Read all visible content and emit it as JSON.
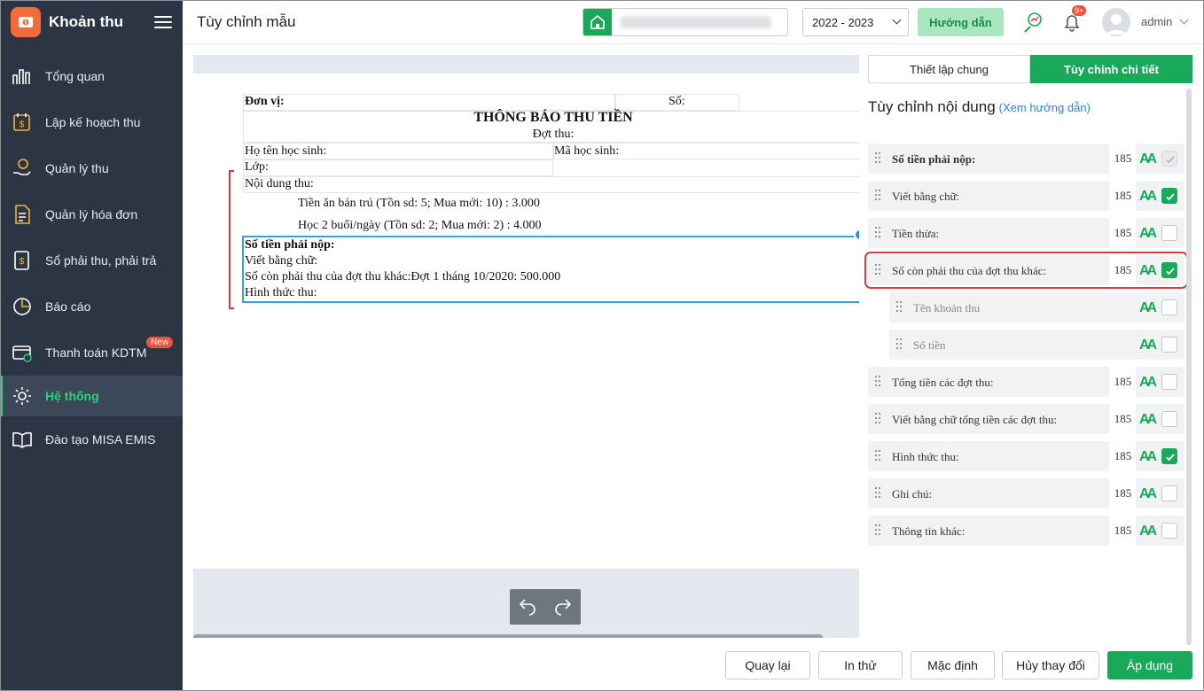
{
  "app": {
    "title": "Khoản thu"
  },
  "sidebar": {
    "items": [
      {
        "label": "Tổng quan"
      },
      {
        "label": "Lập kế hoạch thu"
      },
      {
        "label": "Quản lý thu"
      },
      {
        "label": "Quản lý hóa đơn"
      },
      {
        "label": "Sổ phải thu, phải trả"
      },
      {
        "label": "Báo cáo"
      },
      {
        "label": "Thanh toán KDTM",
        "badge": "New"
      },
      {
        "label": "Hệ thống",
        "active": true
      },
      {
        "label": "Đào tạo MISA EMIS"
      }
    ]
  },
  "header": {
    "page_title": "Tùy chỉnh mẫu",
    "year": "2022 - 2023",
    "guide_label": "Hướng dẫn",
    "notif_count": "9+",
    "username": "admin"
  },
  "doc": {
    "don_vi": "Đơn vị:",
    "so": "Số:",
    "title": "THÔNG BÁO THU TIỀN",
    "dot_thu": "Đợt thu:",
    "ho_ten": "Họ tên học sinh:",
    "ma_hs": "Mã học sinh:",
    "lop": "Lớp:",
    "noi_dung": "Nội dung thu:",
    "item1": "Tiền ăn bán trú (Tồn sd: 5; Mua mới: 10)   : 3.000",
    "item2": "Học 2 buổi/ngày (Tồn sd: 2; Mua mới: 2)   : 4.000",
    "so_tien": "Số tiền phải nộp:",
    "viet_bang_chu": "Viết bằng chữ:",
    "so_con": "Số còn phải thu của đợt thu khác:Đợt 1 tháng 10/2020: 500.000",
    "hinh_thuc": "Hình thức thu:"
  },
  "panel": {
    "tab_general": "Thiết lập chung",
    "tab_detail": "Tùy chỉnh chi tiết",
    "title": "Tùy chỉnh nội dung",
    "guide_link": "(Xem hướng dẫn)",
    "font_glyph": "A",
    "rows": [
      {
        "label": "Số tiền phải nộp:",
        "num": "185",
        "state": "disabled",
        "bold": true
      },
      {
        "label": "Viết bằng chữ:",
        "num": "185",
        "state": "on"
      },
      {
        "label": "Tiền thừa:",
        "num": "185",
        "state": "off"
      },
      {
        "label": "Số còn phải thu của đợt thu khác:",
        "num": "185",
        "state": "on",
        "highlight": true
      },
      {
        "label": "Tên khoản thu",
        "num": "",
        "state": "off",
        "child": true
      },
      {
        "label": "Số tiền",
        "num": "",
        "state": "off",
        "child": true
      },
      {
        "label": "Tổng tiền các đợt thu:",
        "num": "185",
        "state": "off"
      },
      {
        "label": "Viết bằng chữ tổng tiền các đợt thu:",
        "num": "185",
        "state": "off"
      },
      {
        "label": "Hình thức thu:",
        "num": "185",
        "state": "on"
      },
      {
        "label": "Ghi chú:",
        "num": "185",
        "state": "off"
      },
      {
        "label": "Thông tin khác:",
        "num": "185",
        "state": "off"
      }
    ]
  },
  "footer": {
    "back": "Quay lại",
    "print_test": "In thử",
    "default": "Mặc định",
    "cancel": "Hủy thay đổi",
    "apply": "Áp dụng"
  },
  "colors": {
    "brand_green": "#1aa85a",
    "sidebar_bg": "#2b3544",
    "highlight_red": "#e2393f",
    "selection_blue": "#3aa0d8"
  }
}
